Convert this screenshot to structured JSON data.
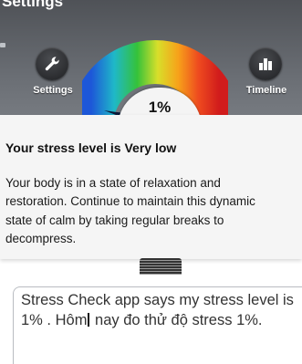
{
  "app": {
    "title": "Settings"
  },
  "toolbar": {
    "settings_label": "Settings",
    "timeline_label": "Timeline"
  },
  "gauge": {
    "value_label": "1%",
    "value_percent": 1,
    "needle_color": "#0a1a3a"
  },
  "info": {
    "title": "Your stress level is Very low",
    "body": "Your body is in a state of relaxation and restoration. Continue to maintain this dynamic state of calm by taking regular breaks to decompress."
  },
  "composer": {
    "text_before_caret": "Stress Check app says my stress level is 1% . Hôm",
    "text_after_caret": " nay đo thử độ stress 1%."
  },
  "icons": {
    "settings": "wrench-icon",
    "timeline": "bar-chart-icon"
  },
  "colors": {
    "top_background": "#5f6368",
    "card_background": "#f5f5f5",
    "composer_border": "#b9bcc1"
  }
}
